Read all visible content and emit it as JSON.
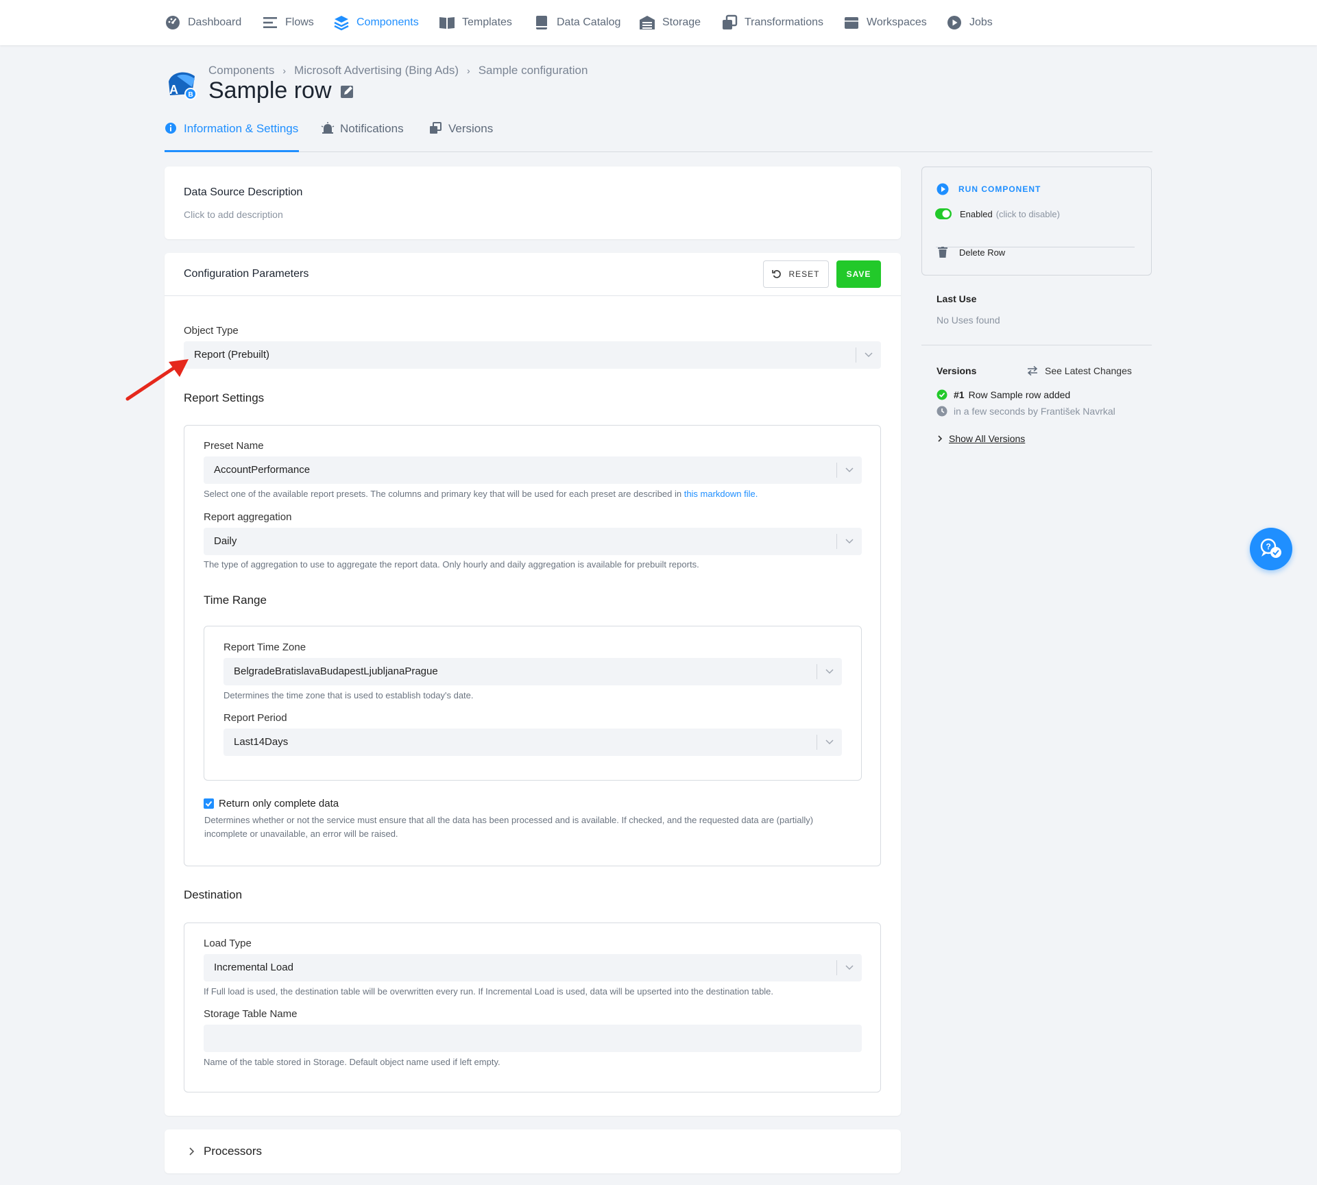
{
  "nav": {
    "items": [
      {
        "label": "Dashboard",
        "icon": "dashboard-icon"
      },
      {
        "label": "Flows",
        "icon": "flows-icon"
      },
      {
        "label": "Components",
        "icon": "components-icon",
        "active": true
      },
      {
        "label": "Templates",
        "icon": "templates-icon"
      },
      {
        "label": "Data Catalog",
        "icon": "data-catalog-icon"
      },
      {
        "label": "Storage",
        "icon": "storage-icon"
      },
      {
        "label": "Transformations",
        "icon": "transformations-icon"
      },
      {
        "label": "Workspaces",
        "icon": "workspaces-icon"
      },
      {
        "label": "Jobs",
        "icon": "jobs-icon"
      }
    ]
  },
  "header": {
    "breadcrumb": [
      "Components",
      "Microsoft Advertising (Bing Ads)",
      "Sample configuration"
    ],
    "title": "Sample row"
  },
  "tabs": [
    {
      "label": "Information & Settings",
      "icon": "info-icon",
      "active": true
    },
    {
      "label": "Notifications",
      "icon": "bell-icon"
    },
    {
      "label": "Versions",
      "icon": "versions-icon"
    }
  ],
  "description": {
    "title": "Data Source Description",
    "placeholder": "Click to add description"
  },
  "config": {
    "title": "Configuration Parameters",
    "reset_label": "RESET",
    "save_label": "SAVE",
    "object_type": {
      "label": "Object Type",
      "value": "Report (Prebuilt)"
    },
    "report_settings": {
      "title": "Report Settings",
      "preset_name": {
        "label": "Preset Name",
        "value": "AccountPerformance",
        "help": "Select one of the available report presets. The columns and primary key that will be used for each preset are described in ",
        "help_link": "this markdown file."
      },
      "aggregation": {
        "label": "Report aggregation",
        "value": "Daily",
        "help": "The type of aggregation to use to aggregate the report data. Only hourly and daily aggregation is available for prebuilt reports."
      },
      "time_range": {
        "title": "Time Range",
        "time_zone": {
          "label": "Report Time Zone",
          "value": "BelgradeBratislavaBudapestLjubljanaPrague",
          "help": "Determines the time zone that is used to establish today's date."
        },
        "period": {
          "label": "Report Period",
          "value": "Last14Days"
        }
      },
      "complete_data": {
        "label": "Return only complete data",
        "checked": true,
        "help_line1": "Determines whether or not the service must ensure that all the data has been processed and is available. If checked, and the requested data are (partially)",
        "help_line2": "incomplete or unavailable, an error will be raised."
      }
    },
    "destination": {
      "title": "Destination",
      "load_type": {
        "label": "Load Type",
        "value": "Incremental Load",
        "help": "If Full load is used, the destination table will be overwritten every run. If Incremental Load is used, data will be upserted into the destination table."
      },
      "table_name": {
        "label": "Storage Table Name",
        "value": "",
        "help": "Name of the table stored in Storage. Default object name used if left empty."
      }
    }
  },
  "processors": {
    "label": "Processors"
  },
  "side": {
    "run_label": "RUN COMPONENT",
    "enabled_label": "Enabled",
    "enabled_hint": "(click to disable)",
    "delete_label": "Delete Row",
    "last_use_title": "Last Use",
    "last_use_value": "No Uses found",
    "versions_title": "Versions",
    "see_changes": "See Latest Changes",
    "version_number": "#1",
    "version_desc": "Row Sample row added",
    "version_meta": "in a few seconds by František Navrkal",
    "show_all": "Show All Versions"
  },
  "colors": {
    "accent": "#1f8fff",
    "save": "#22c92a",
    "annotation_arrow": "#e5281c"
  }
}
